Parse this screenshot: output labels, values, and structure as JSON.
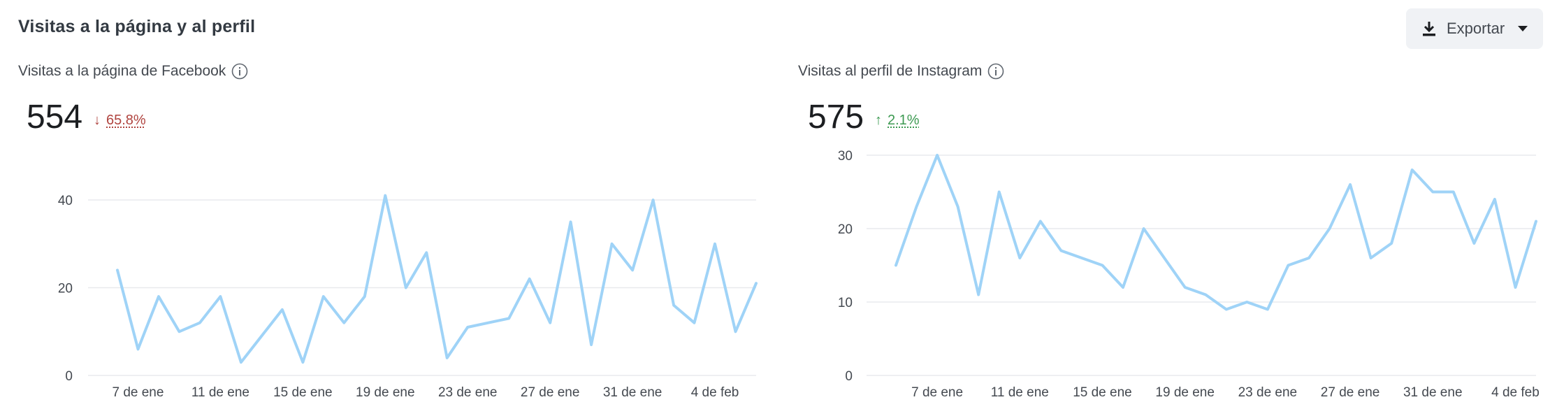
{
  "header": {
    "title": "Visitas a la página y al perfil",
    "export_label": "Exportar"
  },
  "colors": {
    "line": "#9fd3f7",
    "grid": "#e8eaed",
    "down": "#b0443f",
    "up": "#3d9a52"
  },
  "icons": {
    "export": "download-icon",
    "caret": "caret-down-icon",
    "info": "info-icon"
  },
  "facebook": {
    "title": "Visitas a la página de Facebook",
    "value": "554",
    "delta_arrow": "↓",
    "delta": "65.8%"
  },
  "instagram": {
    "title": "Visitas al perfil de Instagram",
    "value": "575",
    "delta_arrow": "↑",
    "delta": "2.1%"
  },
  "chart_data": [
    {
      "type": "line",
      "title": "Visitas a la página de Facebook",
      "xlabel": "",
      "ylabel": "",
      "ylim": [
        0,
        40
      ],
      "yticks": [
        0,
        20,
        40
      ],
      "grid": true,
      "x_tick_labels": [
        "7 de ene",
        "11 de ene",
        "15 de ene",
        "19 de ene",
        "23 de ene",
        "27 de ene",
        "31 de ene",
        "4 de feb"
      ],
      "x_tick_indices": [
        1,
        5,
        9,
        13,
        17,
        21,
        25,
        29
      ],
      "series": [
        {
          "values": [
            24,
            6,
            18,
            10,
            12,
            18,
            3,
            9,
            15,
            3,
            18,
            12,
            18,
            41,
            20,
            28,
            4,
            11,
            12,
            13,
            22,
            12,
            35,
            7,
            30,
            24,
            40,
            16,
            12,
            30,
            10,
            21
          ]
        }
      ]
    },
    {
      "type": "line",
      "title": "Visitas al perfil de Instagram",
      "xlabel": "",
      "ylabel": "",
      "ylim": [
        0,
        30
      ],
      "yticks": [
        0,
        10,
        20,
        30
      ],
      "grid": true,
      "x_tick_labels": [
        "7 de ene",
        "11 de ene",
        "15 de ene",
        "19 de ene",
        "23 de ene",
        "27 de ene",
        "31 de ene",
        "4 de feb"
      ],
      "x_tick_indices": [
        2,
        6,
        10,
        14,
        18,
        22,
        26,
        30
      ],
      "series": [
        {
          "values": [
            15,
            23,
            30,
            23,
            11,
            25,
            16,
            21,
            17,
            16,
            15,
            12,
            20,
            16,
            12,
            11,
            9,
            10,
            9,
            15,
            16,
            20,
            26,
            16,
            18,
            28,
            25,
            25,
            18,
            24,
            12,
            21
          ]
        }
      ]
    }
  ]
}
